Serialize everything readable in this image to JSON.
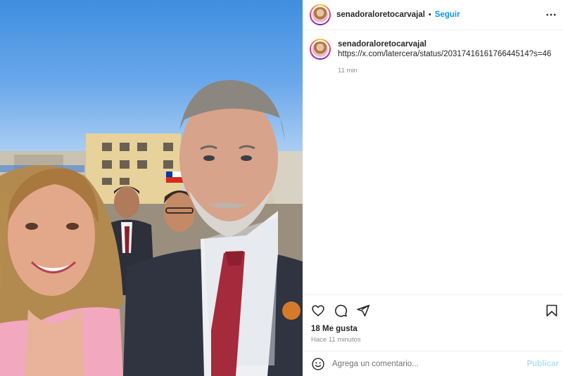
{
  "post": {
    "username": "senadoraloretocarvajal",
    "separator": "•",
    "follow_label": "Seguir",
    "caption_user": "senadoraloretocarvajal",
    "caption_text": "https://x.com/latercera/status/2031741616176644514?s=46",
    "caption_time": "11 min",
    "likes": "18 Me gusta",
    "timestamp": "Hace 11 minutos"
  },
  "comment": {
    "placeholder": "Agrega un comentario...",
    "publish_label": "Publicar"
  },
  "icons": {
    "more": "more-horizontal-icon",
    "like": "heart-icon",
    "comment": "comment-icon",
    "share": "send-icon",
    "save": "bookmark-icon",
    "emoji": "emoji-icon"
  },
  "colors": {
    "link": "#0095f6",
    "publish_disabled": "#b2dffc",
    "muted": "#8e8e8e"
  }
}
